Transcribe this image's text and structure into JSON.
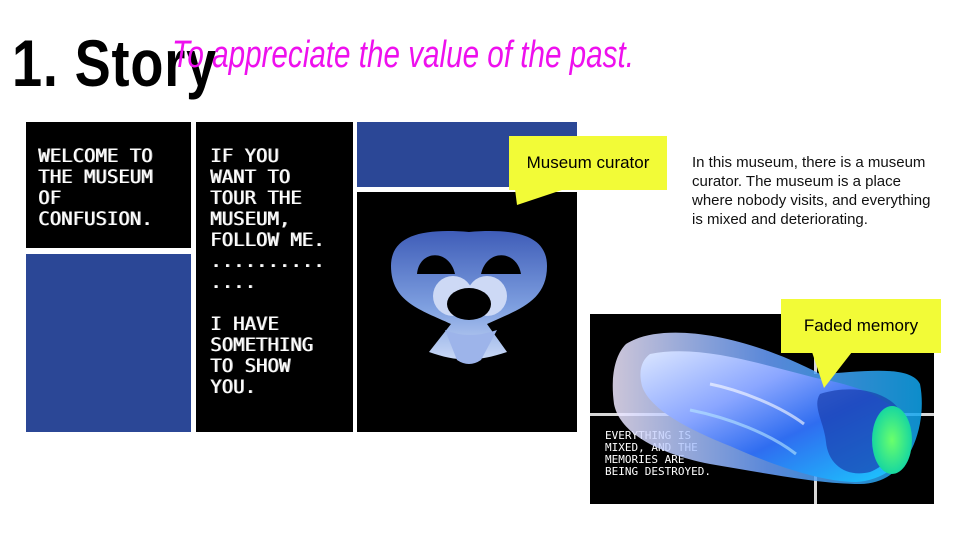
{
  "heading": {
    "title": "1. Story",
    "subtitle": "To appreciate the value of the past."
  },
  "comic": {
    "panel1_text": "WELCOME TO\nTHE MUSEUM\nOF\nCONFUSION.",
    "panel2_text": "IF YOU\nWANT TO\nTOUR THE\nMUSEUM,\nFOLLOW ME.\n..........\n....\n\nI HAVE\nSOMETHING\nTO SHOW\nYOU."
  },
  "callouts": {
    "curator": "Museum curator",
    "memory": "Faded memory"
  },
  "description": "In this museum, there is a museum curator. The museum is a place where nobody visits, and everything is mixed and deteriorating.",
  "memory_image": {
    "caption": "EVERYTHING IS\nMIXED, AND THE\nMEMORIES ARE\nBEING DESTROYED."
  },
  "colors": {
    "accent_magenta": "#ee10ee",
    "callout_yellow": "#f2fb37",
    "panel_blue": "#2b4796"
  }
}
